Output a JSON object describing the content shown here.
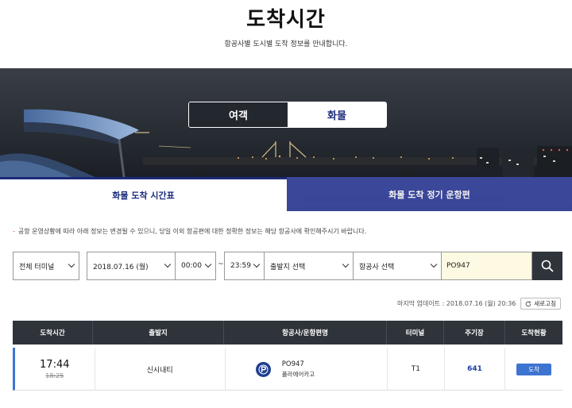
{
  "page": {
    "title": "도착시간",
    "subtitle": "항공사별 도시별 도착 정보를 안내합니다."
  },
  "type_toggle": {
    "passenger": "여객",
    "cargo": "화물",
    "selected": "cargo"
  },
  "tabs": [
    {
      "label": "화물 도착 시간표",
      "active": true
    },
    {
      "label": "화물 도착 정기 운항편",
      "active": false
    }
  ],
  "notice": "공항 운영상황에 따라 아래 정보는 변경될 수 있으니, 당일 이외 항공편에 대한 정확한 정보는 해당 항공사에 확인해주시기 바랍니다.",
  "search": {
    "terminal": "전체 터미널",
    "date": "2018.07.16 (월)",
    "time_from": "00:00",
    "time_separator": "~",
    "time_to": "23:59",
    "origin": "출발지 선택",
    "airline": "항공사 선택",
    "flight_query": "PO947"
  },
  "last_update": {
    "text": "마지막 업데이트 : 2018.07.16 (월) 20:36",
    "refresh_label": "새로고침"
  },
  "table": {
    "headers": [
      "도착시간",
      "출발지",
      "항공사/운항편명",
      "터미널",
      "주기장",
      "도착현황"
    ],
    "rows": [
      {
        "time": "17:44",
        "scheduled": "18:25",
        "origin": "신시내티",
        "flight": "PO947",
        "airline": "폴라에어카고",
        "terminal": "T1",
        "stand": "641",
        "status": "도착"
      }
    ]
  },
  "colors": {
    "navy": "#1b2a7a",
    "tab_inactive": "#3d4aa0",
    "header_dark": "#2f343b",
    "accent_blue": "#3e74d1",
    "flight_field_bg": "#fdf9e2"
  }
}
